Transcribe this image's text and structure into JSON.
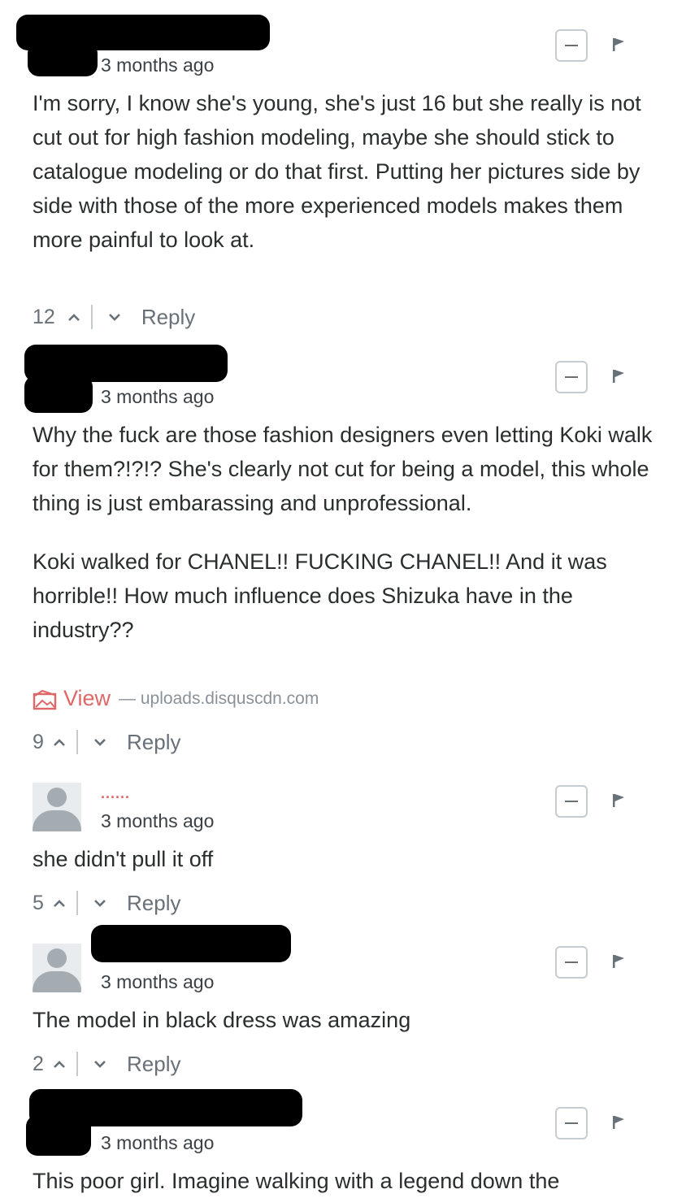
{
  "comments": [
    {
      "time": "3 months ago",
      "paragraphs": [
        "I'm sorry, I know she's young, she's just 16 but she really is not cut out for high fashion modeling, maybe she should stick to catalogue modeling or do that first. Putting her pictures side by side with those of the more experienced models makes them more painful to look at."
      ],
      "votes": "12",
      "reply_label": "Reply"
    },
    {
      "time": "3 months ago",
      "paragraphs": [
        "Why the fuck are those fashion designers even letting Koki walk for them?!?!? She's clearly not cut for being a model, this whole thing is just embarassing and unprofessional.",
        "Koki walked for CHANEL!! FUCKING CHANEL!! And it was horrible!! How much influence does Shizuka have in the industry??"
      ],
      "attachment": {
        "view_label": "View",
        "source": "— uploads.disquscdn.com"
      },
      "votes": "9",
      "reply_label": "Reply"
    },
    {
      "username": "......",
      "time": "3 months ago",
      "paragraphs": [
        "she didn't pull it off"
      ],
      "votes": "5",
      "reply_label": "Reply"
    },
    {
      "time": "3 months ago",
      "paragraphs": [
        "The model in black dress was amazing"
      ],
      "votes": "2",
      "reply_label": "Reply"
    },
    {
      "time": "3 months ago",
      "paragraphs": [
        "This poor girl. Imagine walking with a legend down the"
      ]
    }
  ],
  "colors": {
    "text": "#2a2e2e",
    "meta": "#687178",
    "accent": "#e06767",
    "avatar": "#a4abb1"
  },
  "icons": [
    "collapse-icon",
    "flag-icon",
    "upvote-icon",
    "downvote-icon",
    "image-icon",
    "avatar-placeholder-icon"
  ]
}
